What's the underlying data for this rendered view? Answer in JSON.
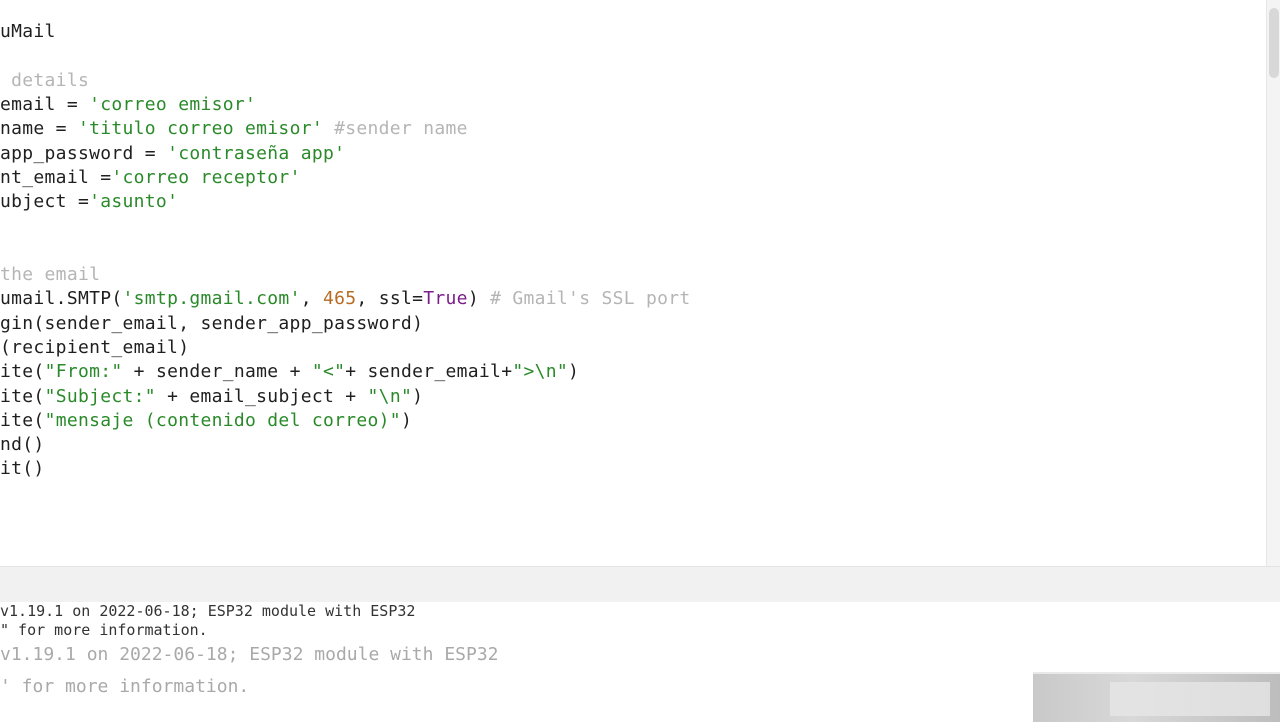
{
  "editor": {
    "lines": [
      [
        [
          "uMail",
          ""
        ]
      ],
      [],
      [
        [
          " details",
          "c"
        ]
      ],
      [
        [
          "email = ",
          ""
        ],
        [
          "'correo emisor'",
          "s"
        ]
      ],
      [
        [
          "name = ",
          ""
        ],
        [
          "'titulo correo emisor'",
          "s"
        ],
        [
          " #sender name",
          "c"
        ]
      ],
      [
        [
          "app_password = ",
          ""
        ],
        [
          "'contraseña app'",
          "s"
        ]
      ],
      [
        [
          "nt_email =",
          ""
        ],
        [
          "'correo receptor'",
          "s"
        ]
      ],
      [
        [
          "ubject =",
          ""
        ],
        [
          "'asunto'",
          "s"
        ]
      ],
      [],
      [],
      [
        [
          "the email",
          "c"
        ]
      ],
      [
        [
          "umail.SMTP(",
          ""
        ],
        [
          "'smtp.gmail.com'",
          "s"
        ],
        [
          ", ",
          ""
        ],
        [
          "465",
          "n"
        ],
        [
          ", ssl=",
          ""
        ],
        [
          "True",
          "k"
        ],
        [
          ") ",
          ""
        ],
        [
          "# Gmail's SSL port",
          "c"
        ]
      ],
      [
        [
          "gin(sender_email, sender_app_password)",
          ""
        ]
      ],
      [
        [
          "(recipient_email)",
          ""
        ]
      ],
      [
        [
          "ite(",
          ""
        ],
        [
          "\"From:\"",
          "s"
        ],
        [
          " + sender_name + ",
          ""
        ],
        [
          "\"<\"",
          "s"
        ],
        [
          "+ sender_email+",
          ""
        ],
        [
          "\">\\n\"",
          "s"
        ],
        [
          ")",
          ""
        ]
      ],
      [
        [
          "ite(",
          ""
        ],
        [
          "\"Subject:\"",
          "s"
        ],
        [
          " + email_subject + ",
          ""
        ],
        [
          "\"\\n\"",
          "s"
        ],
        [
          ")",
          ""
        ]
      ],
      [
        [
          "ite(",
          ""
        ],
        [
          "\"mensaje (contenido del correo)\"",
          "s"
        ],
        [
          ")",
          ""
        ]
      ],
      [
        [
          "nd()",
          ""
        ]
      ],
      [
        [
          "it()",
          ""
        ]
      ]
    ]
  },
  "shell": {
    "line1": "v1.19.1 on 2022-06-18; ESP32 module with ESP32",
    "line2": "\" for more information.",
    "line3": "v1.19.1 on 2022-06-18; ESP32 module with ESP32",
    "line4": "' for more information."
  }
}
